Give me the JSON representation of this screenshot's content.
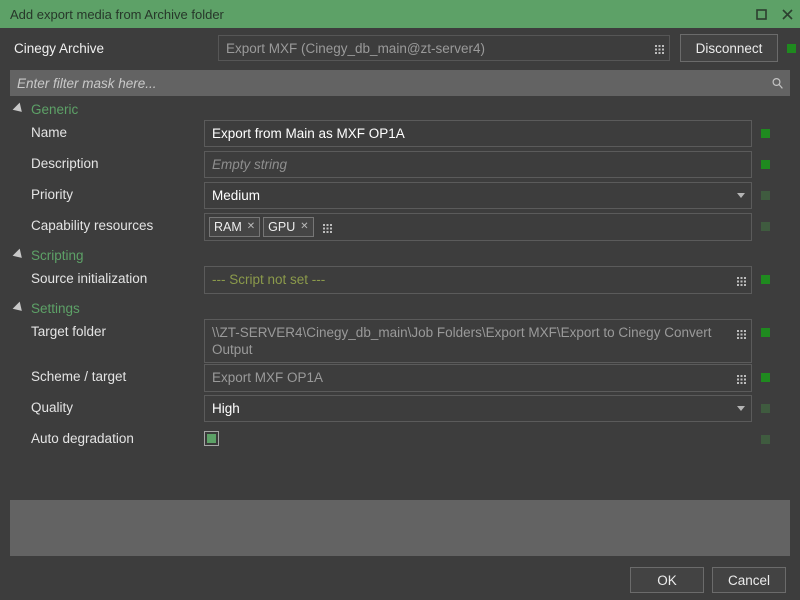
{
  "window": {
    "title": "Add export media from Archive folder",
    "title_bar_color": "#5da167",
    "background_color": "#3d3d3d",
    "maximize_icon": "maximize-icon",
    "close_icon": "close-icon"
  },
  "connection": {
    "label": "Cinegy Archive",
    "value": "Export MXF (Cinegy_db_main@zt-server4)",
    "browse_icon": "grid-browse-icon",
    "disconnect_label": "Disconnect",
    "status_color": "#1f8a1f"
  },
  "filter": {
    "placeholder": "Enter filter mask here...",
    "value": "",
    "search_icon": "search-icon"
  },
  "sections": [
    {
      "name": "Generic",
      "rows": [
        {
          "label": "Name",
          "type": "text",
          "value": "Export from Main as MXF OP1A",
          "state": "value",
          "indicator": "on"
        },
        {
          "label": "Description",
          "type": "text",
          "value": "Empty string",
          "state": "placeholder",
          "indicator": "on"
        },
        {
          "label": "Priority",
          "type": "dropdown",
          "value": "Medium",
          "state": "value",
          "indicator": "off"
        },
        {
          "label": "Capability resources",
          "type": "tags",
          "tags": [
            "RAM",
            "GPU"
          ],
          "indicator": "off"
        }
      ]
    },
    {
      "name": "Scripting",
      "rows": [
        {
          "label": "Source initialization",
          "type": "browse",
          "value": "--- Script not set ---",
          "state": "script",
          "indicator": "on"
        }
      ]
    },
    {
      "name": "Settings",
      "rows": [
        {
          "label": "Target folder",
          "type": "browse",
          "value": "\\\\ZT-SERVER4\\Cinegy_db_main\\Job Folders\\Export MXF\\Export to Cinegy Convert Output",
          "state": "readonly",
          "wrap": true,
          "indicator": "on"
        },
        {
          "label": "Scheme / target",
          "type": "browse",
          "value": "Export MXF OP1A",
          "state": "readonly",
          "indicator": "on"
        },
        {
          "label": "Quality",
          "type": "dropdown",
          "value": "High",
          "state": "value",
          "indicator": "off"
        },
        {
          "label": "Auto degradation",
          "type": "checkbox",
          "checked": true,
          "indicator": "off"
        }
      ]
    }
  ],
  "footer": {
    "ok_label": "OK",
    "cancel_label": "Cancel"
  }
}
